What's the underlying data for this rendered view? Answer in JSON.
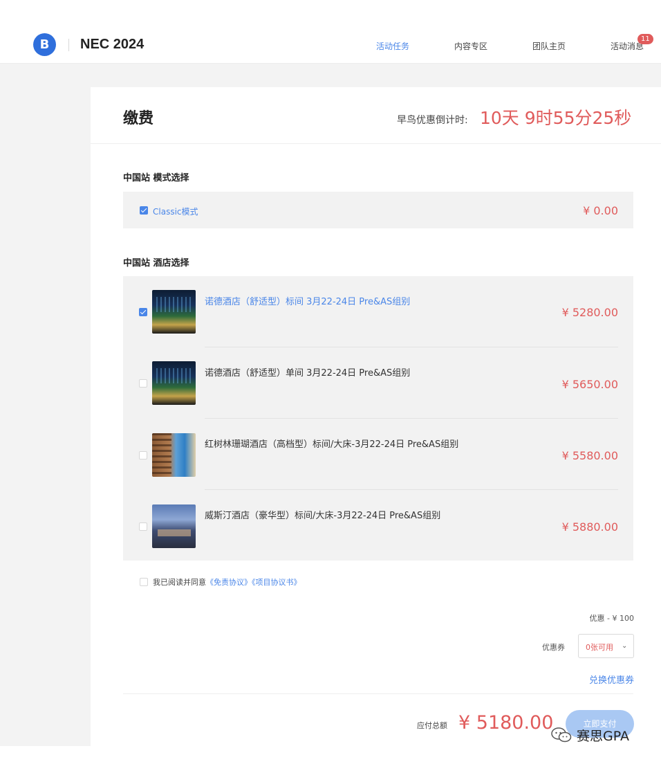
{
  "header": {
    "logo_letter": "B",
    "app_title": "NEC 2024",
    "nav": [
      {
        "label": "活动任务",
        "active": true
      },
      {
        "label": "内容专区",
        "active": false
      },
      {
        "label": "团队主页",
        "active": false
      },
      {
        "label": "活动消息",
        "active": false
      }
    ],
    "message_badge": "11"
  },
  "page": {
    "title": "缴费",
    "countdown_label": "早鸟优惠倒计时:",
    "countdown_value": "10天 9时55分25秒"
  },
  "mode_section": {
    "title": "中国站 模式选择",
    "option": {
      "label": "Classic模式",
      "price": "¥ 0.00",
      "checked": true
    }
  },
  "hotel_section": {
    "title": "中国站 酒店选择",
    "hotels": [
      {
        "label": "诺德酒店（舒适型）标间 3月22-24日 Pre&AS组别",
        "price": "¥ 5280.00",
        "checked": true,
        "thumb": "night-building-photo"
      },
      {
        "label": "诺德酒店（舒适型）单间 3月22-24日 Pre&AS组别",
        "price": "¥ 5650.00",
        "checked": false,
        "thumb": "night-building-photo"
      },
      {
        "label": "红树林珊瑚酒店（高档型）标间/大床-3月22-24日 Pre&AS组别",
        "price": "¥ 5580.00",
        "checked": false,
        "thumb": "coastal-hotel-photo"
      },
      {
        "label": "威斯汀酒店（豪华型）标间/大床-3月22-24日 Pre&AS组别",
        "price": "¥ 5880.00",
        "checked": false,
        "thumb": "dusk-skyline-photo"
      }
    ]
  },
  "agreement": {
    "prefix": "我已阅读并同意",
    "link1": "《免责协议》",
    "link2": "《项目协议书》",
    "checked": false
  },
  "summary": {
    "discount": "优惠 - ¥ 100",
    "coupon_label": "优惠券",
    "coupon_value": "0张可用",
    "redeem_link": "兑换优惠券",
    "total_label": "应付总额",
    "total_value": "¥ 5180.00",
    "pay_button": "立即支付"
  },
  "watermark": {
    "text": "赛思GPA",
    "icon": "wechat-icon"
  },
  "colors": {
    "accent": "#4a86e8",
    "price_red": "#e05b5b",
    "panel_gray": "#f2f2f2"
  }
}
